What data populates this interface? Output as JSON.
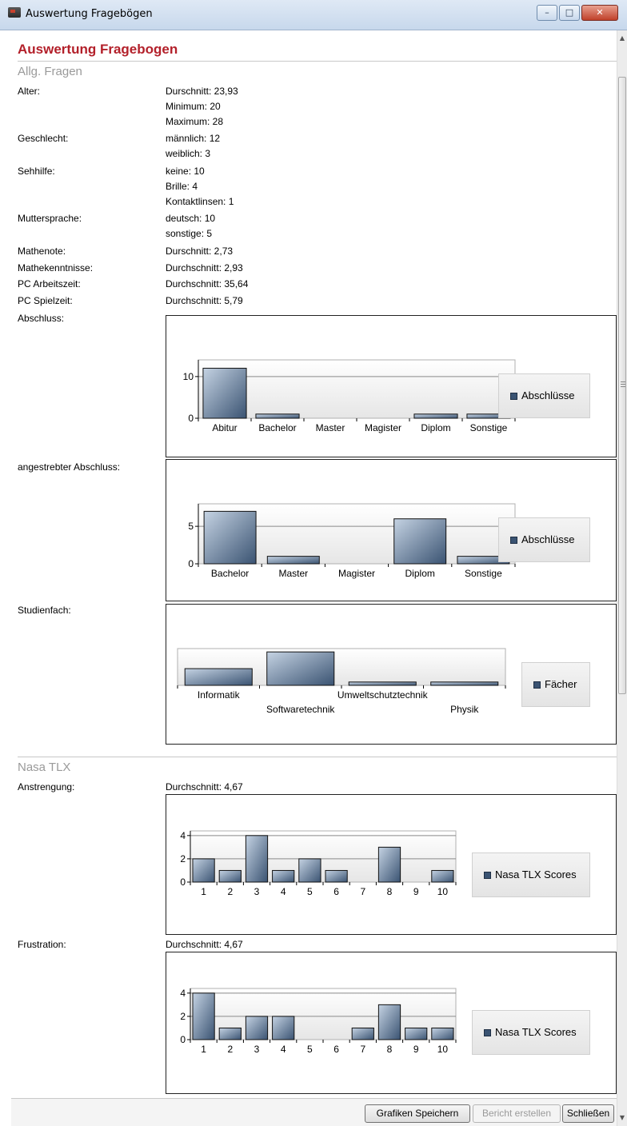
{
  "window": {
    "title": "Auswertung Fragebögen",
    "minimize": "–",
    "maximize": "□",
    "close": "✕"
  },
  "page_title": "Auswertung Fragebogen",
  "sections": {
    "general": "Allg. Fragen",
    "tlx": "Nasa TLX"
  },
  "fields": {
    "alter": {
      "label": "Alter:",
      "lines": [
        "Durschnitt: 23,93",
        "Minimum: 20",
        "Maximum: 28"
      ]
    },
    "geschlecht": {
      "label": "Geschlecht:",
      "lines": [
        "männlich: 12",
        "weiblich: 3"
      ]
    },
    "sehhilfe": {
      "label": "Sehhilfe:",
      "lines": [
        "keine: 10",
        "Brille: 4",
        "Kontaktlinsen: 1"
      ]
    },
    "muttersprache": {
      "label": "Muttersprache:",
      "lines": [
        "deutsch: 10",
        "sonstige: 5"
      ]
    },
    "mathenote": {
      "label": "Mathenote:",
      "value": "Durschnitt: 2,73"
    },
    "mathekenntnisse": {
      "label": "Mathekenntnisse:",
      "value": "Durchschnitt: 2,93"
    },
    "pc_arbeitszeit": {
      "label": "PC Arbeitszeit:",
      "value": "Durchschnitt: 35,64"
    },
    "pc_spielzeit": {
      "label": "PC Spielzeit:",
      "value": "Durchschnitt: 5,79"
    },
    "abschluss": {
      "label": "Abschluss:"
    },
    "angestrebt": {
      "label": "angestrebter Abschluss:"
    },
    "studienfach": {
      "label": "Studienfach:"
    },
    "anstrengung": {
      "label": "Anstrengung:",
      "value": "Durchschnitt: 4,67"
    },
    "frustration": {
      "label": "Frustration:",
      "value": "Durchschnitt: 4,67"
    }
  },
  "colors": {
    "bar_dark": "#3a5372",
    "bar_light": "#c5d3e3",
    "title_red": "#b3202a"
  },
  "chart_data": [
    {
      "id": "abschluss",
      "type": "bar",
      "categories": [
        "Abitur",
        "Bachelor",
        "Master",
        "Magister",
        "Diplom",
        "Sonstige"
      ],
      "values": [
        12,
        1,
        0,
        0,
        1,
        1
      ],
      "ylim": [
        0,
        14
      ],
      "yticks": [
        0,
        10
      ],
      "legend": "Abschlüsse"
    },
    {
      "id": "angestrebt",
      "type": "bar",
      "categories": [
        "Bachelor",
        "Master",
        "Magister",
        "Diplom",
        "Sonstige"
      ],
      "values": [
        7,
        1,
        0,
        6,
        1
      ],
      "ylim": [
        0,
        8
      ],
      "yticks": [
        0,
        5
      ],
      "legend": "Abschlüsse"
    },
    {
      "id": "studienfach",
      "type": "bar",
      "categories": [
        "Informatik",
        "Softwaretechnik",
        "Umweltschutztechnik",
        "Physik"
      ],
      "values": [
        5,
        10,
        1,
        1
      ],
      "ylim": [
        0,
        11
      ],
      "yticks": [],
      "legend": "Fächer"
    },
    {
      "id": "anstrengung",
      "type": "bar",
      "categories": [
        "1",
        "2",
        "3",
        "4",
        "5",
        "6",
        "7",
        "8",
        "9",
        "10"
      ],
      "values": [
        2,
        1,
        4,
        1,
        2,
        1,
        0,
        3,
        0,
        1
      ],
      "ylim": [
        0,
        4.4
      ],
      "yticks": [
        0,
        2,
        4
      ],
      "legend": "Nasa TLX Scores"
    },
    {
      "id": "frustration",
      "type": "bar",
      "categories": [
        "1",
        "2",
        "3",
        "4",
        "5",
        "6",
        "7",
        "8",
        "9",
        "10"
      ],
      "values": [
        4,
        1,
        2,
        2,
        0,
        0,
        1,
        3,
        1,
        1
      ],
      "ylim": [
        0,
        4.4
      ],
      "yticks": [
        0,
        2,
        4
      ],
      "legend": "Nasa TLX Scores"
    }
  ],
  "buttons": {
    "save": "Grafiken Speichern",
    "report": "Bericht erstellen",
    "close": "Schließen"
  }
}
